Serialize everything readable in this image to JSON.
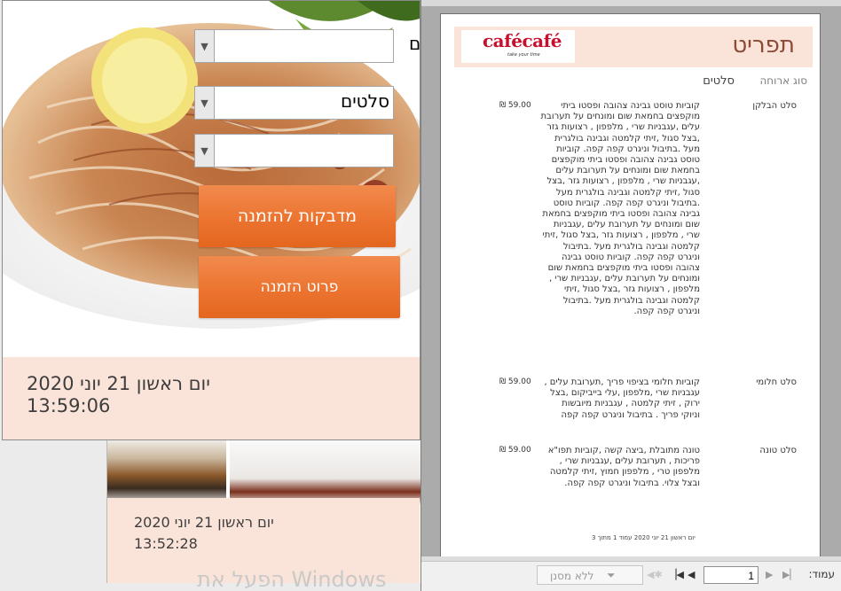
{
  "background_form": {
    "date": "יום ראשון 21 יוני 2020",
    "time": "13:52:28"
  },
  "watermark": "הפעל את Windows",
  "order_form": {
    "edge_char": "ם",
    "combo_top": {
      "value": ""
    },
    "combo_category": {
      "value": "סלטים"
    },
    "combo_bottom": {
      "value": ""
    },
    "labels_button": "מדבקות להזמנה",
    "order_details_button": "פרוט הזמנה",
    "date": "יום ראשון 21 יוני 2020",
    "time": "13:59:06"
  },
  "report": {
    "logo_text": "cafécafé",
    "logo_tagline": "take your time",
    "title": "תפריט",
    "type_label": "סוג ארוחה",
    "type_value": "סלטים",
    "rows": [
      {
        "name": "סלט הבלקן",
        "price": "₪ 59.00",
        "description": "קוביות טוסט גבינה צהובה ופסטו ביתי מוקפצים בחמאת שום ומונחים על תערובת עלים ,עגבניות שרי , מלפפון , רצועות גזר ,בצל סגול ,זיתי קלמטה וגבינה בולגרית מעל .בתיבול וניגרט קפה קפה. קוביות טוסט גבינה צהובה ופסטו ביתי מוקפצים בחמאת שום ומונחים על תערובת עלים ,עגבניות שרי , מלפפון , רצועות גזר ,בצל סגול ,זיתי קלמטה וגבינה בולגרית מעל .בתיבול וניגרט קפה קפה. קוביות טוסט גבינה צהובה ופסטו ביתי מוקפצים בחמאת שום ומונחים על תערובת עלים ,עגבניות שרי , מלפפון , רצועות גזר ,בצל סגול ,זיתי קלמטה וגבינה בולגרית מעל .בתיבול וניגרט קפה קפה. קוביות טוסט גבינה צהובה ופסטו ביתי מוקפצים בחמאת שום ומונחים על תערובת עלים ,עגבניות שרי , מלפפון , רצועות גזר ,בצל סגול ,זיתי קלמטה וגבינה בולגרית מעל .בתיבול וניגרט קפה קפה."
      },
      {
        "name": "סלט חלומי",
        "price": "₪ 59.00",
        "description": "קוביות חלומי בציפוי פריך ,תערובת עלים , עגבניות שרי ,מלפפון ,עלי בייביקום ,בצל ירוק , זיתי קלמטה , עגבניות מיובשות וניוקי פריך . בתיבול וניגרט קפה קפה"
      },
      {
        "name": "סלט טונה",
        "price": "₪ 59.00",
        "description": "טונה מתובלת ,ביצה קשה ,קוביות תפו\"א פריכות , תערובת עלים ,עגבניות שרי , מלפפון טרי , מלפפון חמוץ ,זיתי קלמטה ובצל צלוי. בתיבול וניגרט קפה קפה."
      }
    ],
    "footer": "יום ראשון 21 יוני 2020   עמוד 1 מתוך 3"
  },
  "nav": {
    "page_label": "עמוד:",
    "page_value": "1",
    "filter_label": "ללא מסנן"
  }
}
